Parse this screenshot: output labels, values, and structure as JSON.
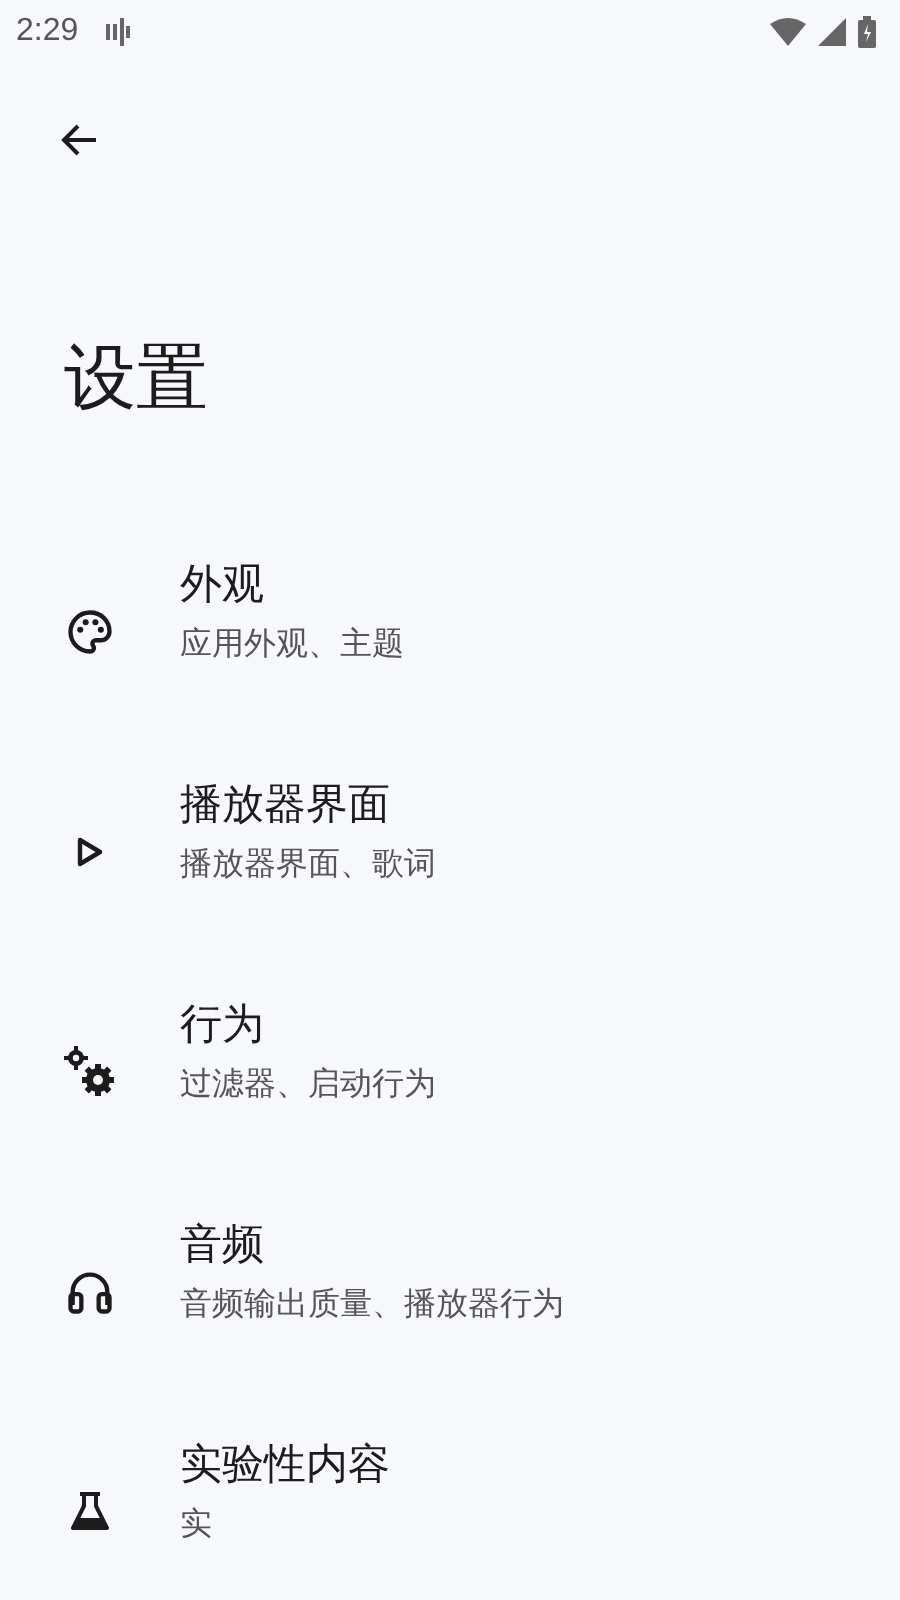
{
  "status_bar": {
    "time": "2:29"
  },
  "title": "设置",
  "items": [
    {
      "title": "外观",
      "subtitle": "应用外观、主题"
    },
    {
      "title": "播放器界面",
      "subtitle": "播放器界面、歌词"
    },
    {
      "title": "行为",
      "subtitle": "过滤器、启动行为"
    },
    {
      "title": "音频",
      "subtitle": "音频输出质量、播放器行为"
    },
    {
      "title": "实验性内容",
      "subtitle": "实"
    }
  ]
}
